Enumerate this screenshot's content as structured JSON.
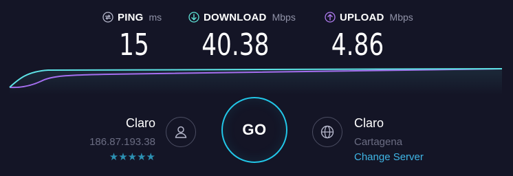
{
  "metrics": {
    "ping": {
      "label": "PING",
      "unit": "ms",
      "value": "15",
      "icon": "ping-icon",
      "icon_color": "#b6b8cc"
    },
    "download": {
      "label": "DOWNLOAD",
      "unit": "Mbps",
      "value": "40.38",
      "icon": "download-arrow-icon",
      "icon_color": "#5fe3d7"
    },
    "upload": {
      "label": "UPLOAD",
      "unit": "Mbps",
      "value": "4.86",
      "icon": "upload-arrow-icon",
      "icon_color": "#b07cf0"
    }
  },
  "graph": {
    "download_color": "#5ee3e6",
    "upload_color": "#a56ff0"
  },
  "go_button": {
    "label": "GO",
    "ring_color": "#22c7e8"
  },
  "isp": {
    "name": "Claro",
    "ip": "186.87.193.38",
    "rating": "★★★★★",
    "rating_value": 5,
    "icon": "user-icon"
  },
  "server": {
    "name": "Claro",
    "location": "Cartagena",
    "change_label": "Change Server",
    "icon": "globe-icon"
  },
  "colors": {
    "background": "#141526",
    "link": "#3fb6e6",
    "muted": "#6b6d83"
  }
}
